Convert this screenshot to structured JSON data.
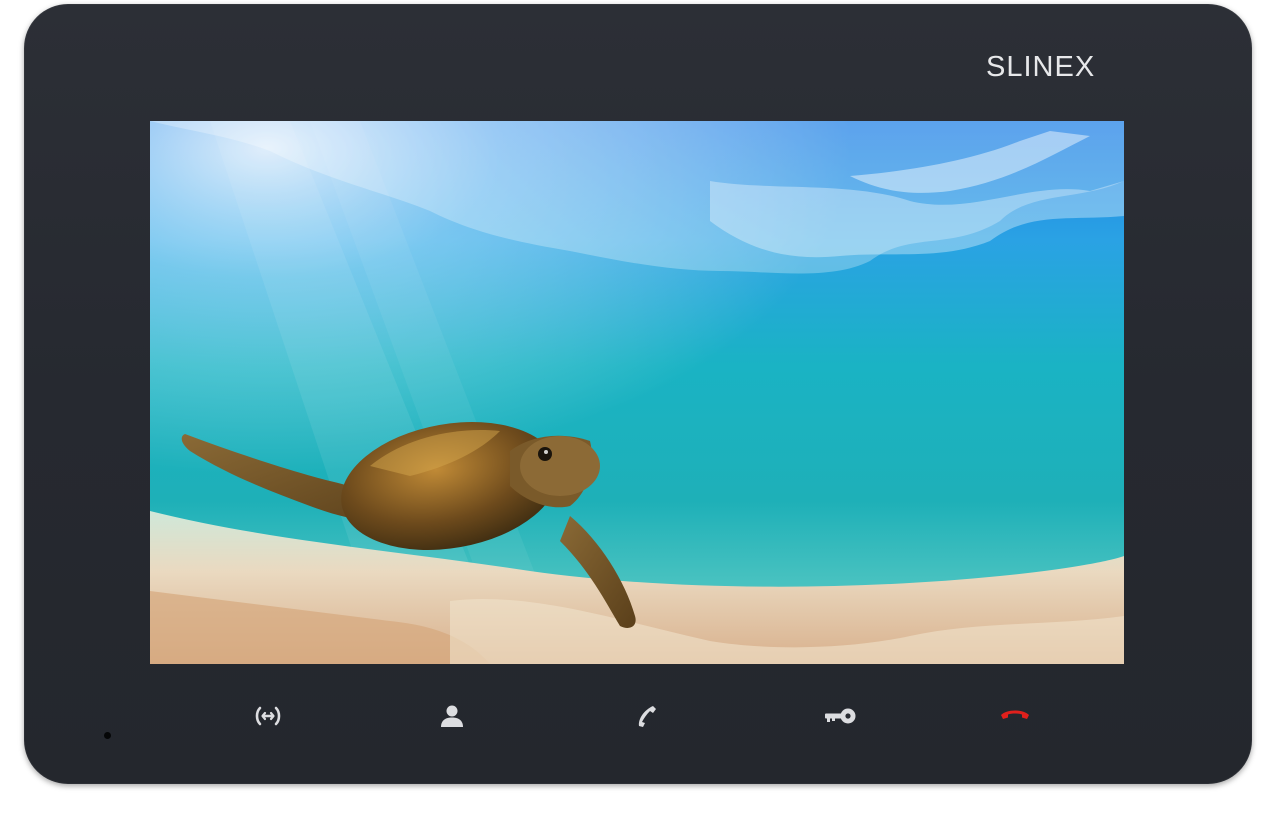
{
  "device": {
    "brand": "SLINEX",
    "body_color": "#282b32",
    "brand_color": "#e7e8ea"
  },
  "screen": {
    "content": "underwater-sea-turtle-image"
  },
  "controls": [
    {
      "name": "monitor-button",
      "icon": "monitor-arrows-icon",
      "color": "#dcdde0"
    },
    {
      "name": "intercom-button",
      "icon": "person-icon",
      "color": "#dcdde0"
    },
    {
      "name": "answer-call-button",
      "icon": "phone-handset-icon",
      "color": "#dcdde0"
    },
    {
      "name": "unlock-door-button",
      "icon": "key-icon",
      "color": "#dcdde0"
    },
    {
      "name": "end-call-button",
      "icon": "phone-hangup-icon",
      "color": "#e0201c"
    }
  ]
}
